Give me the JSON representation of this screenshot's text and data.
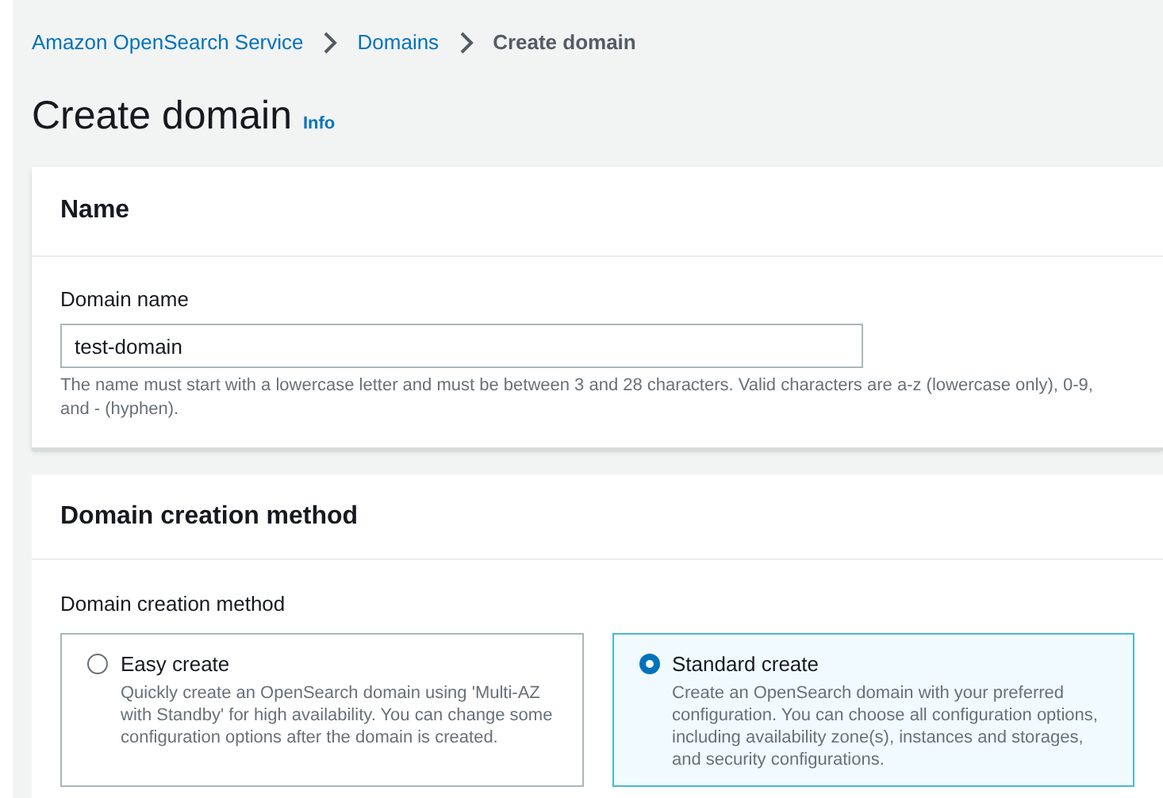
{
  "breadcrumbs": [
    {
      "label": "Amazon OpenSearch Service",
      "kind": "link"
    },
    {
      "label": "Domains",
      "kind": "link"
    },
    {
      "label": "Create domain",
      "kind": "current"
    }
  ],
  "page": {
    "title": "Create domain",
    "info": "Info"
  },
  "name_panel": {
    "heading": "Name",
    "field": {
      "label": "Domain name",
      "value": "test-domain",
      "hint": "The name must start with a lowercase letter and must be between 3 and 28 characters. Valid characters are a-z (lowercase only), 0-9, and - (hyphen)."
    }
  },
  "method_panel": {
    "heading": "Domain creation method",
    "label": "Domain creation method",
    "options": [
      {
        "title": "Easy create",
        "description": "Quickly create an OpenSearch domain using 'Multi-AZ with Standby' for high availability. You can change some configuration options after the domain is created.",
        "selected": false
      },
      {
        "title": "Standard create",
        "description": "Create an OpenSearch domain with your preferred configuration. You can choose all configuration options, including availability zone(s), instances and storages, and security configurations.",
        "selected": true
      }
    ]
  }
}
